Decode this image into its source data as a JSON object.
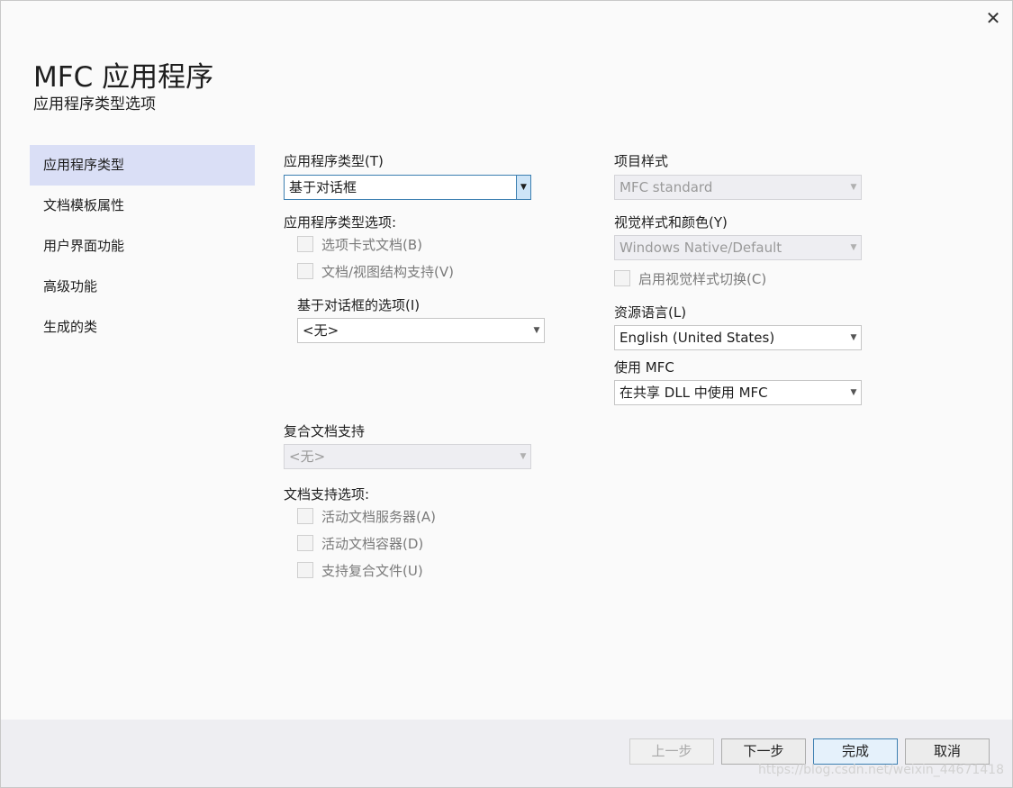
{
  "dialog": {
    "title": "MFC 应用程序",
    "subtitle": "应用程序类型选项",
    "close_glyph": "✕"
  },
  "nav": {
    "items": [
      {
        "label": "应用程序类型"
      },
      {
        "label": "文档模板属性"
      },
      {
        "label": "用户界面功能"
      },
      {
        "label": "高级功能"
      },
      {
        "label": "生成的类"
      }
    ],
    "selected_index": 0
  },
  "left": {
    "app_type_label": "应用程序类型(T)",
    "app_type_value": "基于对话框",
    "app_type_options_label": "应用程序类型选项:",
    "checkboxes": [
      {
        "label": "选项卡式文档(B)",
        "checked": false,
        "enabled": false
      },
      {
        "label": "文档/视图结构支持(V)",
        "checked": false,
        "enabled": false
      }
    ],
    "dialog_options_label": "基于对话框的选项(I)",
    "dialog_options_value": "<无>",
    "compound_label": "复合文档支持",
    "compound_value": "<无>",
    "doc_support_label": "文档支持选项:",
    "doc_checkboxes": [
      {
        "label": "活动文档服务器(A)",
        "checked": false,
        "enabled": false
      },
      {
        "label": "活动文档容器(D)",
        "checked": false,
        "enabled": false
      },
      {
        "label": "支持复合文件(U)",
        "checked": false,
        "enabled": false
      }
    ]
  },
  "right": {
    "project_style_label": "项目样式",
    "project_style_value": "MFC standard",
    "visual_style_label": "视觉样式和颜色(Y)",
    "visual_style_value": "Windows Native/Default",
    "visual_toggle_label": "启用视觉样式切换(C)",
    "resource_lang_label": "资源语言(L)",
    "resource_lang_value": "English (United States)",
    "use_mfc_label": "使用 MFC",
    "use_mfc_value": "在共享 DLL 中使用 MFC"
  },
  "footer": {
    "prev_label": "上一步",
    "next_label": "下一步",
    "finish_label": "完成",
    "cancel_label": "取消",
    "watermark": "https://blog.csdn.net/weixin_44671418"
  },
  "icons": {
    "dropdown_arrow": "▼"
  },
  "colors": {
    "selected_nav_bg": "#dadff6",
    "focus_border": "#3c7fb1",
    "footer_bg": "#eeeef2"
  }
}
